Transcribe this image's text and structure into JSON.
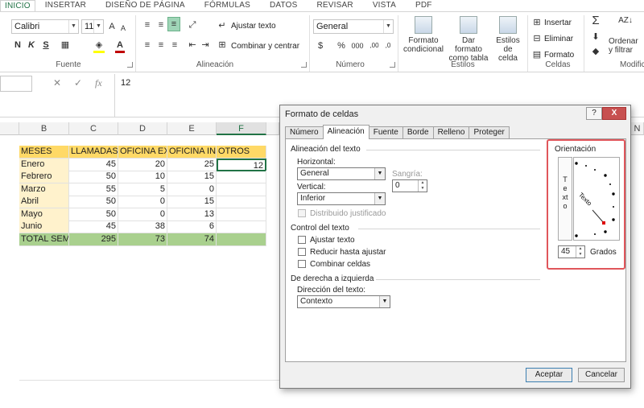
{
  "ribbon_tabs": [
    "INICIO",
    "INSERTAR",
    "DISEÑO DE PÁGINA",
    "FÓRMULAS",
    "DATOS",
    "REVISAR",
    "VISTA",
    "PDF"
  ],
  "ribbon": {
    "font_name": "Calibri",
    "font_size": "11",
    "bold": "N",
    "italic": "K",
    "underline": "S",
    "wrap_text": "Ajustar texto",
    "merge_center": "Combinar y centrar",
    "number_format": "General",
    "percent": "%",
    "thousands": "000",
    "decimals_inc": ",00",
    "decimals_dec": ",0",
    "cond_format_1": "Formato",
    "cond_format_2": "condicional",
    "table_format_1": "Dar formato",
    "table_format_2": "como tabla",
    "cell_styles_1": "Estilos de",
    "cell_styles_2": "celda",
    "insert": "Insertar",
    "delete": "Eliminar",
    "format": "Formato",
    "sort_1": "Ordenar",
    "sort_2": "y filtrar",
    "groups": {
      "font": "Fuente",
      "alignment": "Alineación",
      "number": "Número",
      "styles": "Estilos",
      "cells": "Celdas",
      "modify": "Modific"
    }
  },
  "formula_bar": {
    "value": "12",
    "cancel": "✕",
    "confirm": "✓",
    "fx": "fx"
  },
  "grid": {
    "columns": [
      "B",
      "C",
      "D",
      "E",
      "F"
    ],
    "rows": [
      [
        "MESES",
        "LLAMADAS",
        "OFICINA EXT",
        "OFICINA INT",
        "OTROS"
      ],
      [
        "Enero",
        "45",
        "20",
        "25",
        "12"
      ],
      [
        "Febrero",
        "50",
        "10",
        "15",
        ""
      ],
      [
        "Marzo",
        "55",
        "5",
        "0",
        ""
      ],
      [
        "Abril",
        "50",
        "0",
        "15",
        ""
      ],
      [
        "Mayo",
        "50",
        "0",
        "13",
        ""
      ],
      [
        "Junio",
        "45",
        "38",
        "6",
        ""
      ],
      [
        "TOTAL SEMESTRE",
        "295",
        "73",
        "74",
        ""
      ]
    ],
    "right_col_label": "N"
  },
  "dialog": {
    "title": "Formato de celdas",
    "help": "?",
    "close": "X",
    "tabs": [
      "Número",
      "Alineación",
      "Fuente",
      "Borde",
      "Relleno",
      "Proteger"
    ],
    "active_tab": "Alineación",
    "text_alignment_section": "Alineación del texto",
    "horizontal_label": "Horizontal:",
    "horizontal_value": "General",
    "indent_label": "Sangría:",
    "indent_value": "0",
    "vertical_label": "Vertical:",
    "vertical_value": "Inferior",
    "distributed_label": "Distribuido justificado",
    "text_control_section": "Control del texto",
    "wrap_label": "Ajustar texto",
    "shrink_label": "Reducir hasta ajustar",
    "merge_label": "Combinar celdas",
    "rtl_section": "De derecha a izquierda",
    "direction_label": "Dirección del texto:",
    "direction_value": "Contexto",
    "orientation_section": "Orientación",
    "vertical_text": "Texto",
    "rotated_text": "Texto",
    "degrees_value": "45",
    "degrees_label": "Grados",
    "ok": "Aceptar",
    "cancel": "Cancelar"
  },
  "colors": {
    "accent": "#217346",
    "header_fill": "#ffd966",
    "month_fill": "#fff2cc",
    "total_fill": "#a9d08e",
    "highlight": "#e0565b"
  }
}
